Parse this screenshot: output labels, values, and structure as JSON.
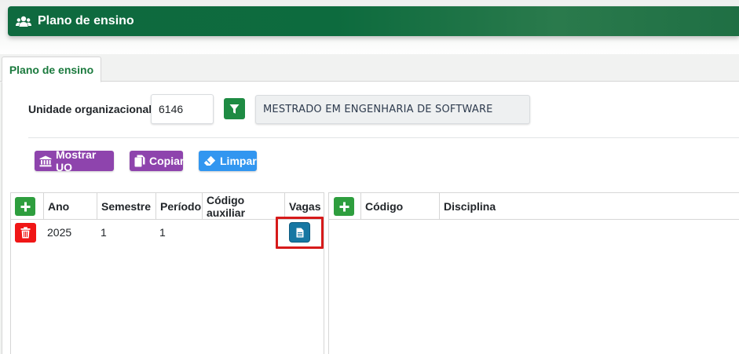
{
  "header": {
    "title": "Plano de ensino",
    "icon": "users-icon"
  },
  "tabs": [
    {
      "label": "Plano de ensino",
      "active": true
    }
  ],
  "form": {
    "uo_label": "Unidade organizacional:",
    "uo_code": "6146",
    "uo_name": "MESTRADO EM ENGENHARIA DE SOFTWARE"
  },
  "actions": {
    "mostrar_uo": "Mostrar UO",
    "copiar": "Copiar",
    "limpar": "Limpar"
  },
  "left_table": {
    "columns": [
      "Ano",
      "Semestre",
      "Período",
      "Código auxiliar",
      "Vagas"
    ],
    "rows": [
      {
        "ano": "2025",
        "semestre": "1",
        "periodo": "1",
        "codigo_auxiliar": ""
      }
    ]
  },
  "right_table": {
    "columns": [
      "Código",
      "Disciplina"
    ],
    "rows": []
  },
  "colors": {
    "header_green": "#0f6a3f",
    "filter_green": "#1e8b43",
    "purple": "#8e44ad",
    "blue": "#3296f0",
    "add_green": "#2e9e3e",
    "delete_red": "#f01616",
    "vagas_blue": "#1677a3",
    "highlight_red": "#d61a1a"
  }
}
